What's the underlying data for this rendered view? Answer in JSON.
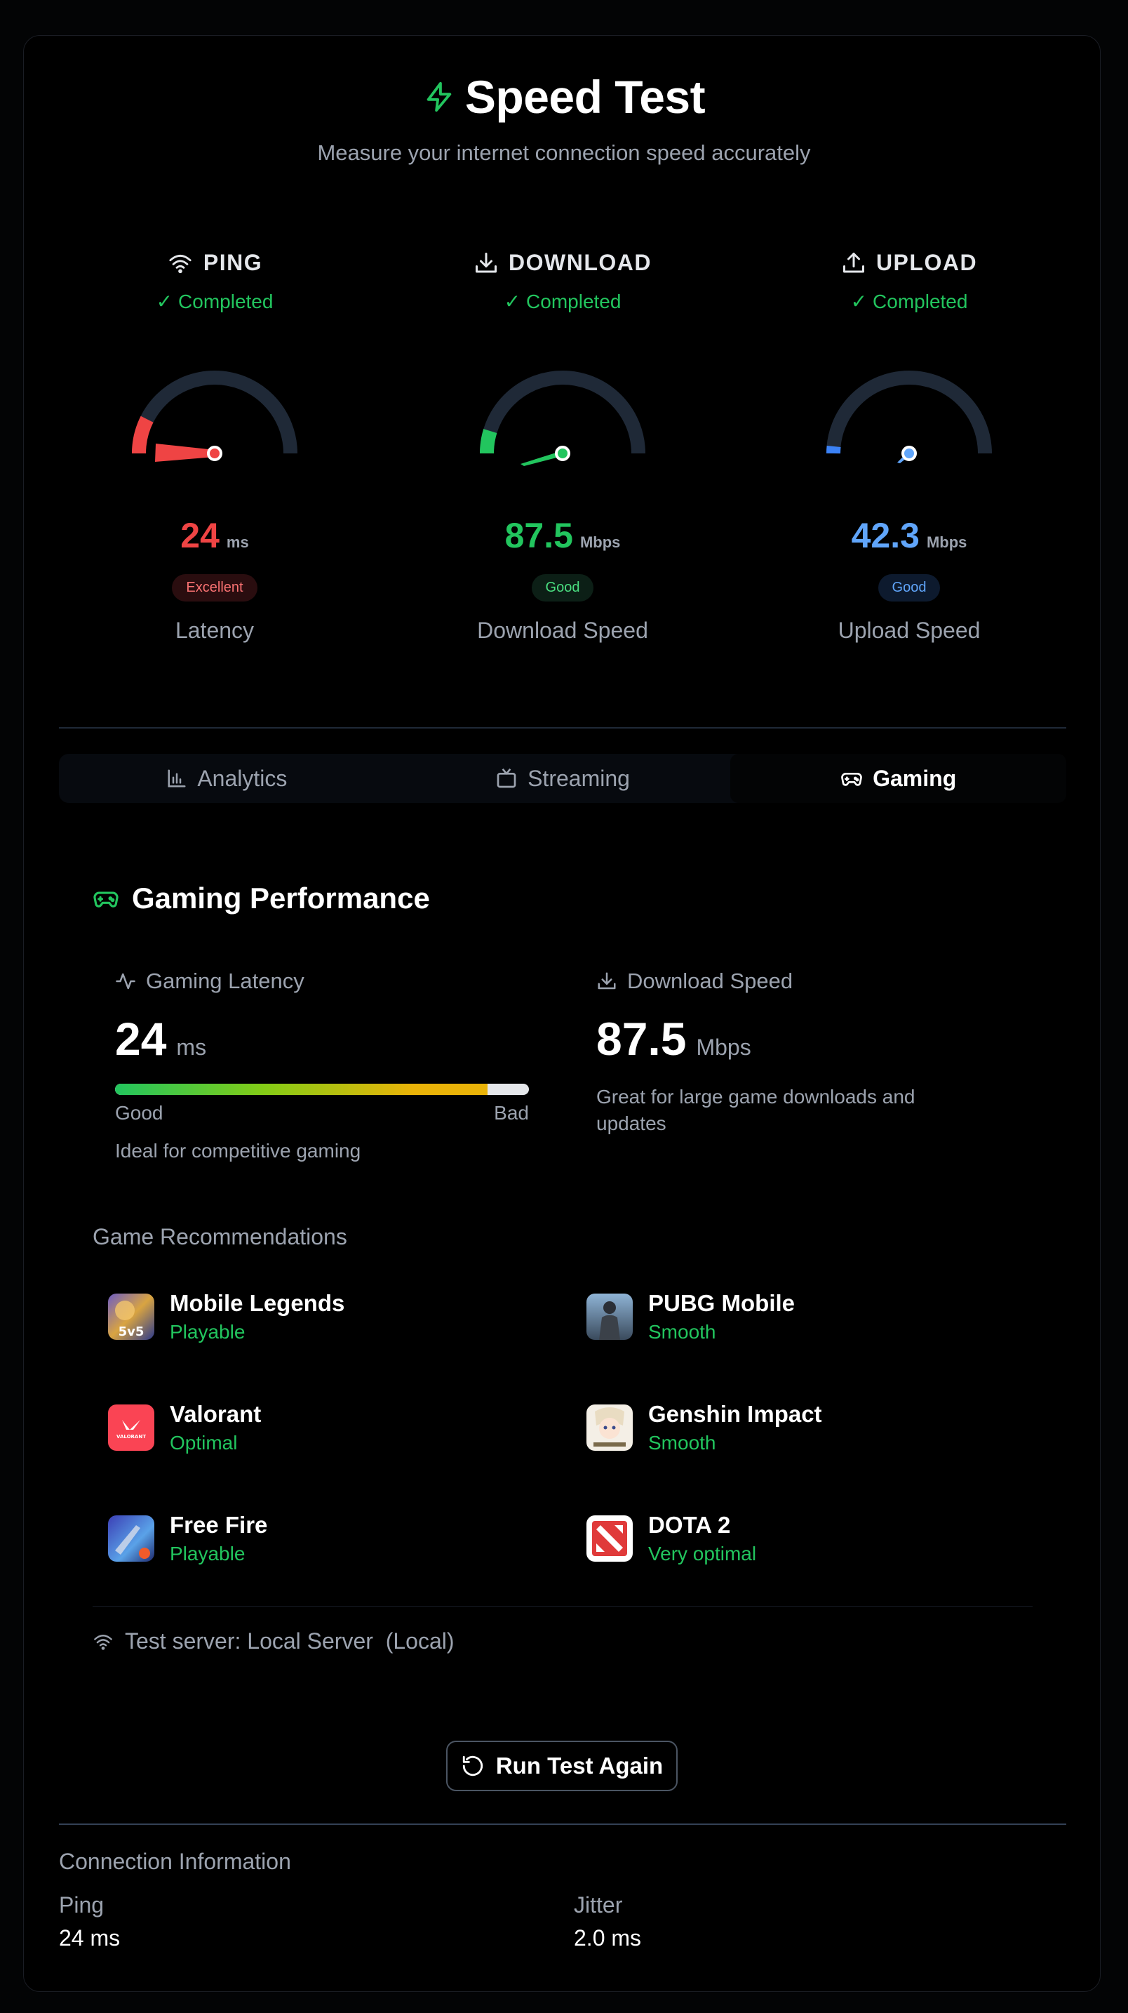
{
  "header": {
    "title": "Speed Test",
    "subtitle": "Measure your internet connection speed accurately",
    "accent": "#22c55e"
  },
  "metrics": [
    {
      "heading": "PING",
      "icon": "wifi-icon",
      "status": "Completed",
      "value": "24",
      "unit": "ms",
      "badge": "Excellent",
      "label": "Latency",
      "color": "#ef4444",
      "gauge_fraction": 0.08
    },
    {
      "heading": "DOWNLOAD",
      "icon": "download-icon",
      "status": "Completed",
      "value": "87.5",
      "unit": "Mbps",
      "badge": "Good",
      "label": "Download Speed",
      "color": "#22c55e",
      "gauge_fraction": 0.07
    },
    {
      "heading": "UPLOAD",
      "icon": "upload-icon",
      "status": "Completed",
      "value": "42.3",
      "unit": "Mbps",
      "badge": "Good",
      "label": "Upload Speed",
      "color": "#60a5fa",
      "gauge_fraction": 0.03
    }
  ],
  "tabs": [
    {
      "label": "Analytics",
      "icon": "bar-chart-icon",
      "active": false
    },
    {
      "label": "Streaming",
      "icon": "tv-icon",
      "active": false
    },
    {
      "label": "Gaming",
      "icon": "gamepad-icon",
      "active": true
    }
  ],
  "gaming": {
    "title": "Gaming Performance",
    "latency": {
      "label": "Gaming Latency",
      "value": "24",
      "unit": "ms",
      "bar_fraction": 0.9,
      "good_label": "Good",
      "bad_label": "Bad",
      "note": "Ideal for competitive gaming"
    },
    "download": {
      "label": "Download Speed",
      "value": "87.5",
      "unit": "Mbps",
      "note": "Great for large game downloads and updates"
    },
    "recommendations_title": "Game Recommendations",
    "games": [
      {
        "name": "Mobile Legends",
        "status": "Playable"
      },
      {
        "name": "PUBG Mobile",
        "status": "Smooth"
      },
      {
        "name": "Valorant",
        "status": "Optimal"
      },
      {
        "name": "Genshin Impact",
        "status": "Smooth"
      },
      {
        "name": "Free Fire",
        "status": "Playable"
      },
      {
        "name": "DOTA 2",
        "status": "Very optimal"
      }
    ],
    "server": "Test server: Local Server  (Local)"
  },
  "run_button": "Run Test Again",
  "connection": {
    "title": "Connection Information",
    "items": [
      {
        "key": "Ping",
        "value": "24 ms"
      },
      {
        "key": "Jitter",
        "value": "2.0 ms"
      }
    ]
  }
}
